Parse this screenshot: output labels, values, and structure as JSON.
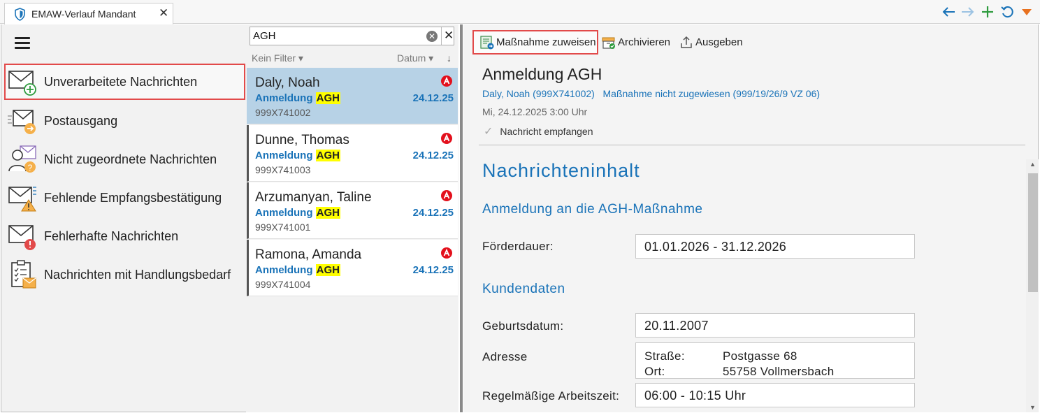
{
  "tab": {
    "title": "EMAW-Verlauf Mandant",
    "close": "✕"
  },
  "search": {
    "value": "AGH",
    "clear": "✕",
    "close": "✕"
  },
  "filter": {
    "filter_label": "Kein Filter ▾",
    "sort_label": "Datum ▾",
    "sort_dir": "↓"
  },
  "sidebar": {
    "items": [
      {
        "label": "Unverarbeitete Nachrichten",
        "icon": "mail-add-icon"
      },
      {
        "label": "Postausgang",
        "icon": "mail-outbox-icon"
      },
      {
        "label": "Nicht zugeordnete Nachrichten",
        "icon": "person-question-icon"
      },
      {
        "label": "Fehlende Empfangsbestätigung",
        "icon": "mail-warning-icon"
      },
      {
        "label": "Fehlerhafte Nachrichten",
        "icon": "mail-error-icon"
      },
      {
        "label": "Nachrichten mit Handlungsbedarf",
        "icon": "clipboard-mail-icon"
      }
    ]
  },
  "messages": [
    {
      "name": "Daly, Noah",
      "subject_prefix": "Anmeldung",
      "subject_highlight": "AGH",
      "date": "24.12.25",
      "id": "999X741002"
    },
    {
      "name": "Dunne, Thomas",
      "subject_prefix": "Anmeldung",
      "subject_highlight": "AGH",
      "date": "24.12.25",
      "id": "999X741003"
    },
    {
      "name": "Arzumanyan, Taline",
      "subject_prefix": "Anmeldung",
      "subject_highlight": "AGH",
      "date": "24.12.25",
      "id": "999X741001"
    },
    {
      "name": "Ramona, Amanda",
      "subject_prefix": "Anmeldung",
      "subject_highlight": "AGH",
      "date": "24.12.25",
      "id": "999X741004"
    }
  ],
  "toolbar": {
    "assign_label": "Maßnahme zuweisen",
    "archive_label": "Archivieren",
    "export_label": "Ausgeben"
  },
  "detail": {
    "title": "Anmeldung AGH",
    "person_link": "Daly, Noah (999X741002)",
    "measure_link": "Maßnahme nicht zugewiesen (999/19/26/9 VZ 06)",
    "date": "Mi, 24.12.2025 3:00 Uhr",
    "status": "Nachricht empfangen",
    "status_check": "✓"
  },
  "content": {
    "heading": "Nachrichteninhalt",
    "section1": "Anmeldung an die AGH-Maßnahme",
    "foerderdauer_label": "Förderdauer:",
    "foerderdauer_value": "01.01.2026 - 31.12.2026",
    "section2": "Kundendaten",
    "geburtsdatum_label": "Geburtsdatum:",
    "geburtsdatum_value": "20.11.2007",
    "adresse_label": "Adresse",
    "strasse_key": "Straße:",
    "strasse_value": "Postgasse 68",
    "ort_key": "Ort:",
    "ort_value": "55758 Vollmersbach",
    "arbeitszeit_label": "Regelmäßige Arbeitszeit:",
    "arbeitszeit_value": "06:00 - 10:15 Uhr"
  },
  "colors": {
    "accent": "#1a73b8",
    "highlight": "#e24a4a",
    "selected": "#b7d2e6"
  }
}
